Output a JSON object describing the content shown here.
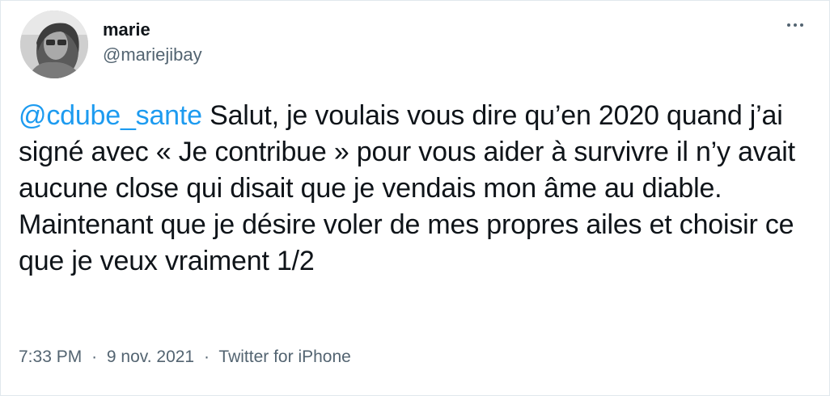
{
  "author": {
    "display_name": "marie",
    "handle": "@mariejibay",
    "avatar_icon": "profile-photo"
  },
  "more_icon": "more-horizontal-icon",
  "tweet": {
    "mention": "@cdube_sante",
    "text": " Salut, je voulais vous dire qu’en 2020 quand j’ai signé avec « Je contribue » pour vous aider à survivre il n’y avait aucune close qui disait que je vendais mon âme au diable. Maintenant que je désire voler de mes propres ailes et choisir ce que je veux vraiment 1/2"
  },
  "meta": {
    "time": "7:33 PM",
    "separator": "·",
    "date": "9 nov. 2021",
    "source": "Twitter for iPhone"
  },
  "colors": {
    "mention": "#1d9bf0",
    "text": "#0f1419",
    "secondary": "#536471",
    "border": "#e1e8ed"
  }
}
